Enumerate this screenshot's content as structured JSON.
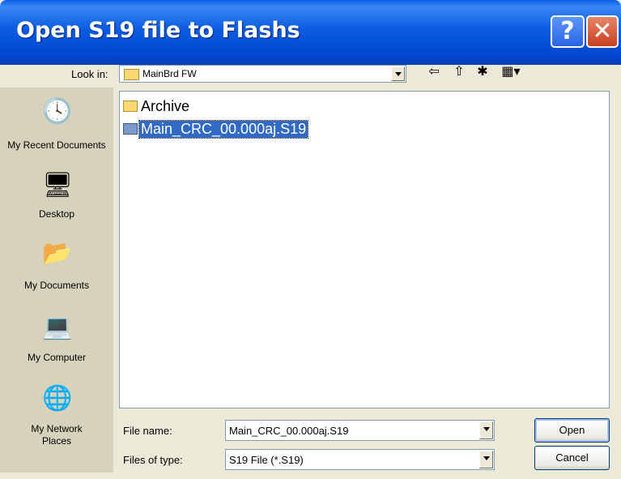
{
  "window": {
    "title": "Open S19 file to Flashs",
    "help_glyph": "?",
    "close_glyph": "✕"
  },
  "toolbar": {
    "look_in_label": "Look in:",
    "look_in_value": "MainBrd FW",
    "back_glyph": "⇦",
    "up_glyph": "⇧",
    "new_folder_glyph": "✱",
    "views_glyph": "▦▾"
  },
  "places": [
    {
      "label": "My Recent Documents",
      "icon": "recent-documents-icon",
      "glyph": "🕓"
    },
    {
      "label": "Desktop",
      "icon": "desktop-icon",
      "glyph": "🖥"
    },
    {
      "label": "My Documents",
      "icon": "my-documents-icon",
      "glyph": "📂"
    },
    {
      "label": "My Computer",
      "icon": "my-computer-icon",
      "glyph": "💻"
    },
    {
      "label": "My Network Places",
      "icon": "network-places-icon",
      "glyph": "🌐"
    }
  ],
  "files": [
    {
      "name": "Archive",
      "type": "folder",
      "selected": false
    },
    {
      "name": "Main_CRC_00.000aj.S19",
      "type": "file",
      "selected": true
    }
  ],
  "fields": {
    "file_name_label": "File name:",
    "file_name_value": "Main_CRC_00.000aj.S19",
    "file_type_label": "Files of type:",
    "file_type_value": "S19 File (*.S19)"
  },
  "buttons": {
    "open": "Open",
    "cancel": "Cancel"
  },
  "colors": {
    "title_bar": "#0A5FEA",
    "selection": "#316AC5",
    "dialog_bg": "#ECE9D8"
  }
}
